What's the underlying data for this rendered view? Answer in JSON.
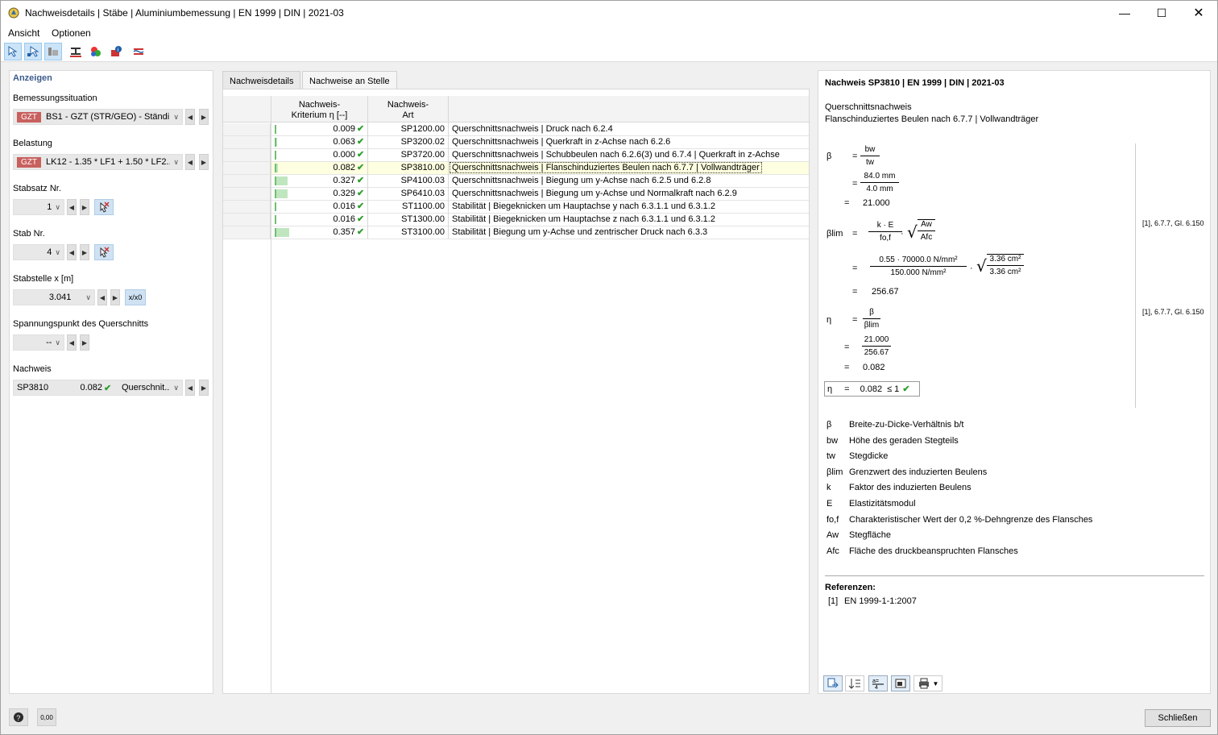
{
  "window": {
    "title": "Nachweisdetails | Stäbe | Aluminiumbemessung | EN 1999 | DIN | 2021-03",
    "minimize_icon": "minimize-icon",
    "maximize_icon": "maximize-icon",
    "close_icon": "close-icon"
  },
  "menu": [
    "Ansicht",
    "Optionen"
  ],
  "toolbar": {
    "icons": [
      "select-member-icon",
      "select-set-icon",
      "filter-icon",
      "section-icon",
      "color-scale-icon",
      "info-icon",
      "show-results-icon"
    ]
  },
  "left": {
    "section_title": "Anzeigen",
    "design_situation": {
      "label": "Bemessungssituation",
      "badge": "GZT",
      "value": "BS1 - GZT (STR/GEO) - Ständi..."
    },
    "loading": {
      "label": "Belastung",
      "badge": "GZT",
      "value": "LK12 - 1.35 * LF1 + 1.50 * LF2..."
    },
    "member_set": {
      "label": "Stabsatz Nr.",
      "value": "1"
    },
    "member": {
      "label": "Stab Nr.",
      "value": "4"
    },
    "location": {
      "label": "Stabstelle x [m]",
      "value": "3.041",
      "button": "x/x0"
    },
    "stress_point": {
      "label": "Spannungspunkt des Querschnitts",
      "value": "--"
    },
    "check": {
      "label": "Nachweis",
      "id": "SP3810",
      "ratio": "0.082",
      "type": "Querschnit..."
    }
  },
  "tabs": [
    "Nachweisdetails",
    "Nachweise an Stelle"
  ],
  "grid": {
    "headers": {
      "ratio": [
        "Nachweis-",
        "Kriterium η [--]"
      ],
      "type": [
        "Nachweis-",
        "Art"
      ]
    },
    "rows": [
      {
        "ratio": 0.009,
        "ratio_text": "0.009",
        "code": "SP1200.00",
        "desc": "Querschnittsnachweis | Druck nach 6.2.4"
      },
      {
        "ratio": 0.063,
        "ratio_text": "0.063",
        "code": "SP3200.02",
        "desc": "Querschnittsnachweis | Querkraft in z-Achse nach 6.2.6"
      },
      {
        "ratio": 0.0,
        "ratio_text": "0.000",
        "code": "SP3720.00",
        "desc": "Querschnittsnachweis | Schubbeulen nach 6.2.6(3) und 6.7.4 | Querkraft in z-Achse"
      },
      {
        "ratio": 0.082,
        "ratio_text": "0.082",
        "code": "SP3810.00",
        "desc": "Querschnittsnachweis | Flanschinduziertes Beulen nach 6.7.7 | Vollwandträger"
      },
      {
        "ratio": 0.327,
        "ratio_text": "0.327",
        "code": "SP4100.03",
        "desc": "Querschnittsnachweis | Biegung um y-Achse nach 6.2.5 und 6.2.8"
      },
      {
        "ratio": 0.329,
        "ratio_text": "0.329",
        "code": "SP6410.03",
        "desc": "Querschnittsnachweis | Biegung um y-Achse und Normalkraft nach 6.2.9"
      },
      {
        "ratio": 0.016,
        "ratio_text": "0.016",
        "code": "ST1100.00",
        "desc": "Stabilität | Biegeknicken um Hauptachse y nach 6.3.1.1 und 6.3.1.2"
      },
      {
        "ratio": 0.016,
        "ratio_text": "0.016",
        "code": "ST1300.00",
        "desc": "Stabilität | Biegeknicken um Hauptachse z nach 6.3.1.1 und 6.3.1.2"
      },
      {
        "ratio": 0.357,
        "ratio_text": "0.357",
        "code": "ST3100.00",
        "desc": "Stabilität | Biegung um y-Achse und zentrischer Druck nach 6.3.3"
      }
    ]
  },
  "details": {
    "heading": "Nachweis SP3810 | EN 1999 | DIN | 2021-03",
    "subtitle1": "Querschnittsnachweis",
    "subtitle2": "Flanschinduziertes Beulen nach 6.7.7 | Vollwandträger",
    "beta": {
      "sym": "β",
      "num": "bw",
      "den": "tw",
      "num2": "84.0 mm",
      "den2": "4.0 mm",
      "result": "21.000"
    },
    "beta_lim": {
      "sym": "βlim",
      "num": "k · E",
      "den": "fo,f",
      "rnum": "Aw",
      "rden": "Afc",
      "num2": "0.55  ·  70000.0 N/mm²",
      "den2": "150.000 N/mm²",
      "rnum2": "3.36 cm²",
      "rden2": "3.36 cm²",
      "result": "256.67",
      "ref": "[1], 6.7.7, Gl. 6.150"
    },
    "eta": {
      "sym": "η",
      "num": "β",
      "den": "βlim",
      "num2": "21.000",
      "den2": "256.67",
      "result": "0.082",
      "ref": "[1], 6.7.7, Gl. 6.150"
    },
    "final": {
      "sym": "η",
      "eq": "=",
      "value": "0.082",
      "cond": "≤ 1"
    },
    "legend": [
      {
        "sym": "β",
        "text": "Breite-zu-Dicke-Verhältnis b/t"
      },
      {
        "sym": "bw",
        "text": "Höhe des geraden Stegteils"
      },
      {
        "sym": "tw",
        "text": "Stegdicke"
      },
      {
        "sym": "βlim",
        "text": "Grenzwert des induzierten Beulens"
      },
      {
        "sym": "k",
        "text": "Faktor des induzierten Beulens"
      },
      {
        "sym": "E",
        "text": "Elastizitätsmodul"
      },
      {
        "sym": "fo,f",
        "text": "Charakteristischer Wert der 0,2 %-Dehngrenze des Flansches"
      },
      {
        "sym": "Aw",
        "text": "Stegfläche"
      },
      {
        "sym": "Afc",
        "text": "Fläche des druckbeanspruchten Flansches"
      }
    ],
    "refs_title": "Referenzen:",
    "refs": [
      {
        "id": "[1]",
        "text": "EN 1999-1-1:2007"
      }
    ]
  },
  "footer": {
    "close": "Schließen",
    "help_icon": "help-icon",
    "units_icon": "decimal-places-icon",
    "units_text": "0,00"
  },
  "colors": {
    "badge": "#c8605e",
    "bar": "#bfe6bf",
    "check": "#2f9e2f",
    "section": "#3c5c8c"
  }
}
